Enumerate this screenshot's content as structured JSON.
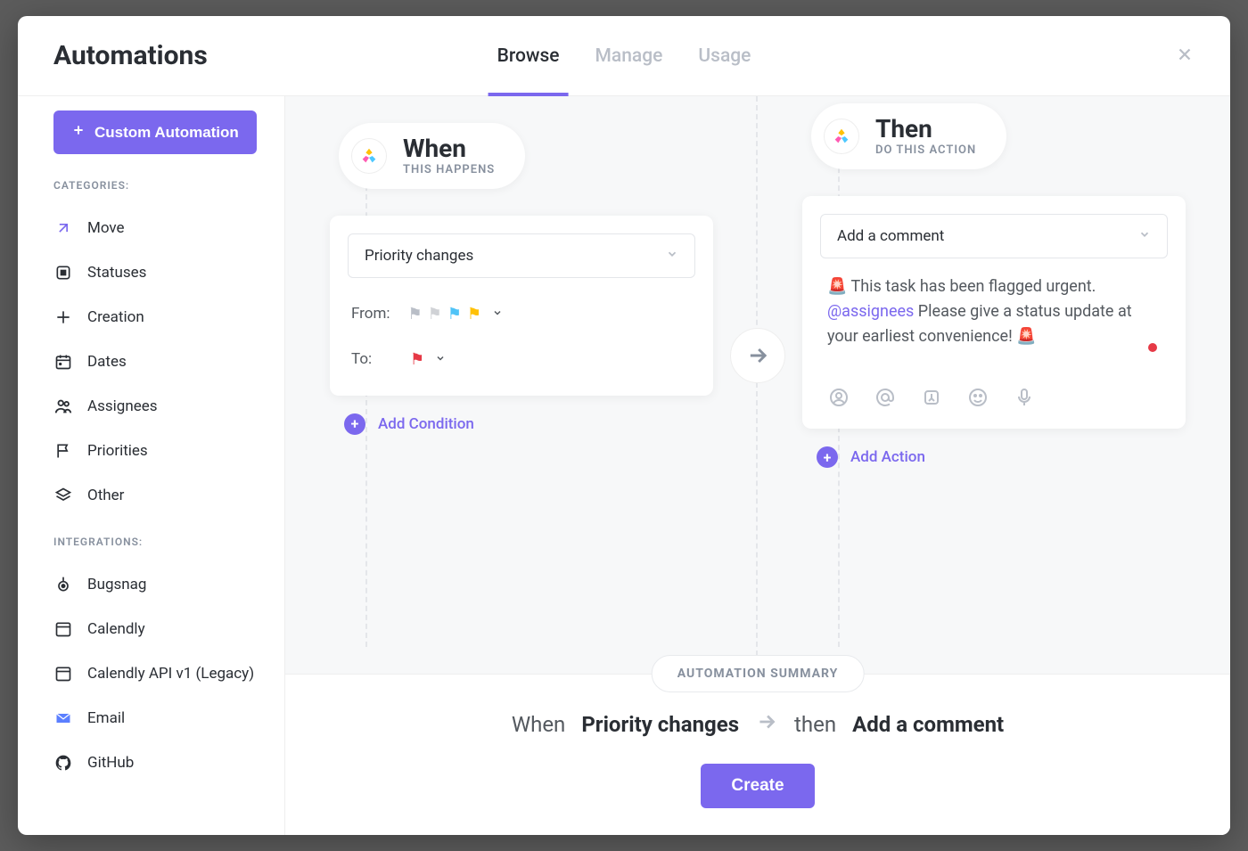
{
  "modal": {
    "title": "Automations",
    "tabs": [
      "Browse",
      "Manage",
      "Usage"
    ],
    "active_tab": "Browse"
  },
  "sidebar": {
    "custom_button": "Custom Automation",
    "categories_label": "CATEGORIES:",
    "categories": [
      {
        "id": "move",
        "label": "Move",
        "icon": "move-icon"
      },
      {
        "id": "statuses",
        "label": "Statuses",
        "icon": "status-icon"
      },
      {
        "id": "creation",
        "label": "Creation",
        "icon": "creation-icon"
      },
      {
        "id": "dates",
        "label": "Dates",
        "icon": "calendar-icon"
      },
      {
        "id": "assignees",
        "label": "Assignees",
        "icon": "assignees-icon"
      },
      {
        "id": "priorities",
        "label": "Priorities",
        "icon": "flag-icon"
      },
      {
        "id": "other",
        "label": "Other",
        "icon": "layers-icon"
      }
    ],
    "integrations_label": "INTEGRATIONS:",
    "integrations": [
      {
        "id": "bugsnag",
        "label": "Bugsnag",
        "icon": "bugsnag-icon"
      },
      {
        "id": "calendly",
        "label": "Calendly",
        "icon": "calendly-icon"
      },
      {
        "id": "calendly-legacy",
        "label": "Calendly API v1 (Legacy)",
        "icon": "calendly-icon"
      },
      {
        "id": "email",
        "label": "Email",
        "icon": "email-icon"
      },
      {
        "id": "github",
        "label": "GitHub",
        "icon": "github-icon"
      }
    ]
  },
  "builder": {
    "when": {
      "title": "When",
      "subtitle": "THIS HAPPENS",
      "trigger": "Priority changes",
      "from_label": "From:",
      "to_label": "To:",
      "from_flags": [
        "#b9bec7",
        "#d0d2d6",
        "#4fc3f7",
        "#ffc107"
      ],
      "to_flag": "#e63946",
      "add_condition": "Add Condition"
    },
    "then": {
      "title": "Then",
      "subtitle": "DO THIS ACTION",
      "action": "Add a comment",
      "comment_prefix": "🚨 This task has been flagged urgent. ",
      "comment_mention": "@assignees",
      "comment_suffix": " Please give a status update at your earliest convenience! 🚨",
      "add_action": "Add Action"
    }
  },
  "summary": {
    "label": "AUTOMATION SUMMARY",
    "when_prefix": "When",
    "when_bold": "Priority changes",
    "then_prefix": "then",
    "then_bold": "Add a comment",
    "create": "Create"
  }
}
